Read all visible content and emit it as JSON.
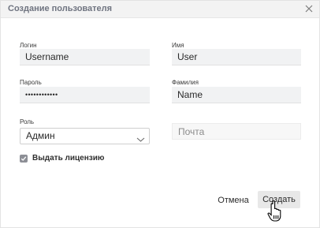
{
  "dialog": {
    "title": "Создание пользователя"
  },
  "form": {
    "login_label": "Логин",
    "login_value": "Username",
    "name_label": "Имя",
    "name_value": "User",
    "password_label": "Пароль",
    "password_value": "••••••••••••",
    "surname_label": "Фамилия",
    "surname_value": "Name",
    "role_label": "Роль",
    "role_value": "Админ",
    "email_placeholder": "Почта",
    "license_label": "Выдать лицензию",
    "license_checked": true
  },
  "buttons": {
    "cancel": "Отмена",
    "create": "Создать"
  },
  "icons": {
    "close": "close-icon",
    "chevron": "chevron-down-icon",
    "check": "check-icon",
    "cursor": "hand-pointer-cursor"
  }
}
